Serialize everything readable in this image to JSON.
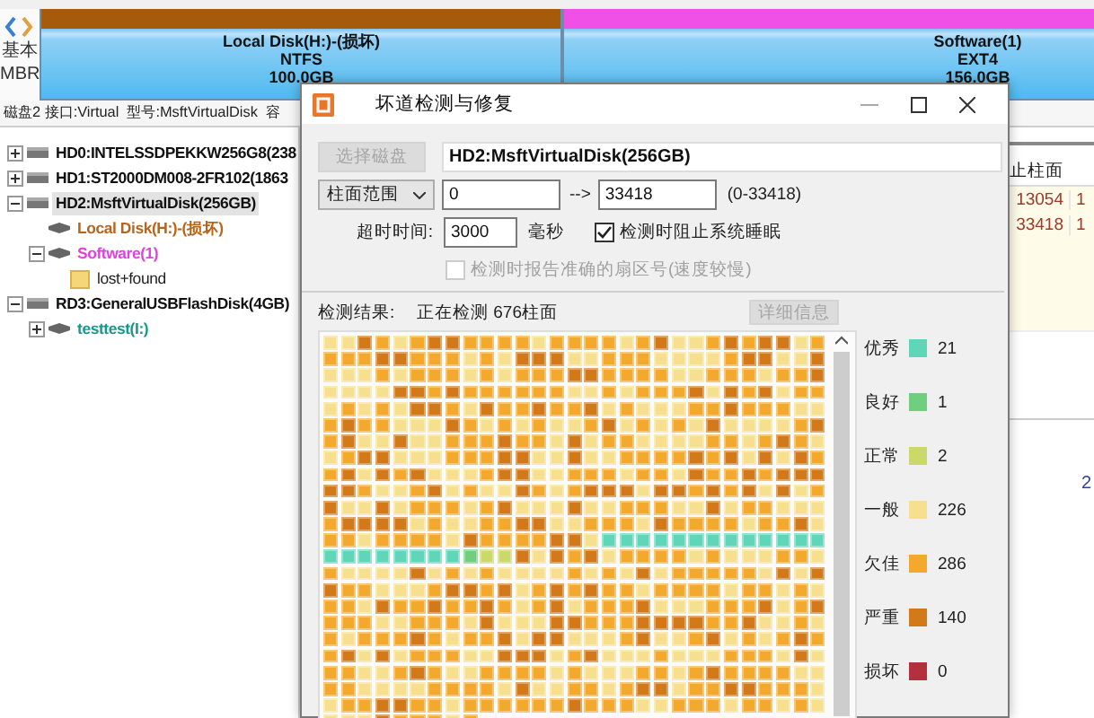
{
  "nav": {
    "line_1": "基本",
    "line_2": "MBR"
  },
  "disk_map": {
    "partitions": [
      {
        "name": "Local Disk(H:)-(损坏)",
        "filesystem": "NTFS",
        "size": "100.0GB",
        "color": "#a65a0c"
      },
      {
        "name": "Software(1)",
        "filesystem": "EXT4",
        "size": "156.0GB",
        "color": "#f050e6"
      }
    ]
  },
  "disk_info": "磁盘2 接口:Virtual  型号:MsftVirtualDisk  容",
  "tree": [
    {
      "label": "HD0:INTELSSDPEKKW256G8(238",
      "kind": "disk",
      "expanded": false,
      "selected": false
    },
    {
      "label": "HD1:ST2000DM008-2FR102(1863",
      "kind": "disk",
      "expanded": false,
      "selected": false
    },
    {
      "label": "HD2:MsftVirtualDisk(256GB)",
      "kind": "disk",
      "expanded": true,
      "selected": true,
      "children": [
        {
          "label": "Local Disk(H:)-(损坏)",
          "kind": "partition",
          "color": "#b8651a",
          "selected": false
        },
        {
          "label": "Software(1)",
          "kind": "partition",
          "color": "#e040e0",
          "expanded": true,
          "selected": false,
          "children": [
            {
              "label": "lost+found",
              "kind": "folder",
              "selected": false
            }
          ]
        }
      ]
    },
    {
      "label": "RD3:GeneralUSBFlashDisk(4GB)",
      "kind": "disk",
      "expanded": true,
      "selected": false,
      "children": [
        {
          "label": "testtest(I:)",
          "kind": "partition",
          "color": "#17998a",
          "expanded": false,
          "selected": false
        }
      ]
    }
  ],
  "partition_table": {
    "column_1": "止柱面",
    "rows": [
      {
        "column_1": "13054",
        "column_2": "1"
      },
      {
        "column_1": "33418",
        "column_2": "1"
      }
    ]
  },
  "lower_pane": {
    "text": "2"
  },
  "dialog": {
    "title": "坏道检测与修复",
    "select_button": {
      "label": "选择磁盘",
      "disabled": true
    },
    "disk": "HD2:MsftVirtualDisk(256GB)",
    "range_mode": "柱面范围",
    "range_from": "0",
    "range_arrow": "-->",
    "range_to": "33418",
    "range_hint": "(0-33418)",
    "timeout_label": "超时时间:",
    "timeout": "3000",
    "timeout_unit": "毫秒",
    "options": [
      {
        "label": "检测时阻止系统睡眠",
        "checked": true,
        "disabled": false
      },
      {
        "label": "检测时报告准确的扇区号(速度较慢)",
        "checked": false,
        "disabled": true
      }
    ],
    "result_label": "检测结果:",
    "status": "正在检测 676柱面",
    "details_button": {
      "label": "详细信息",
      "disabled": true
    },
    "legend": [
      {
        "label": "优秀",
        "color": "#5fd6b8",
        "count": "21"
      },
      {
        "label": "良好",
        "color": "#6fcf7e",
        "count": "1"
      },
      {
        "label": "正常",
        "color": "#cbd96b",
        "count": "2"
      },
      {
        "label": "一般",
        "color": "#f6df8f",
        "count": "226"
      },
      {
        "label": "欠佳",
        "color": "#f2a92e",
        "count": "286"
      },
      {
        "label": "严重",
        "color": "#d2791a",
        "count": "140"
      },
      {
        "label": "损坏",
        "color": "#b3303f",
        "count": "0"
      }
    ]
  }
}
